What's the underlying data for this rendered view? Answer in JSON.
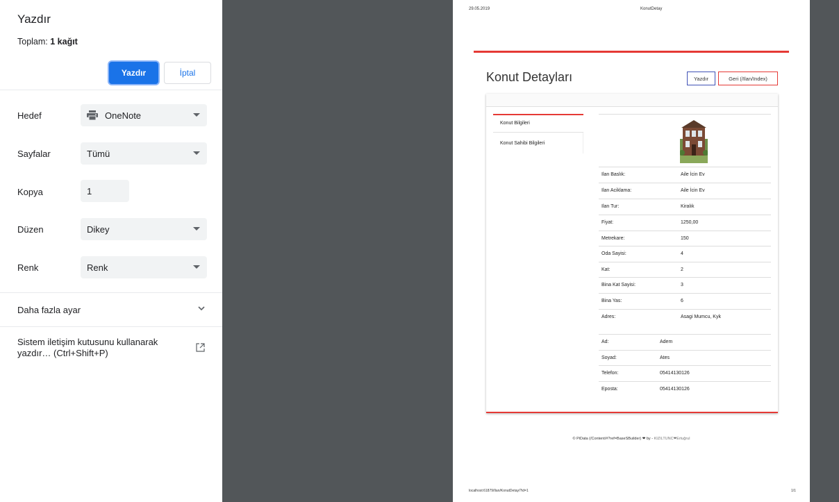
{
  "panel": {
    "title": "Yazdır",
    "total_prefix": "Toplam: ",
    "total_value": "1 kağıt",
    "print_button": "Yazdır",
    "cancel_button": "İptal",
    "rows": {
      "destination": {
        "label": "Hedef",
        "value": "OneNote"
      },
      "pages": {
        "label": "Sayfalar",
        "value": "Tümü"
      },
      "copies": {
        "label": "Kopya",
        "value": "1"
      },
      "layout": {
        "label": "Düzen",
        "value": "Dikey"
      },
      "color": {
        "label": "Renk",
        "value": "Renk"
      }
    },
    "more_settings": "Daha fazla ayar",
    "system_dialog": "Sistem iletişim kutusunu kullanarak yazdır… (Ctrl+Shift+P)",
    "accent_color": "#1a73e8"
  },
  "preview": {
    "header_date": "29.05.2019",
    "header_title": "KonutDetay",
    "page_title": "Konut Detayları",
    "print_button": "Yazdır",
    "back_button": "Geri (/Ilan/Index)",
    "tabs": [
      "Konut Bilgileri",
      "Konut Sahibi Bilgileri"
    ],
    "property": [
      {
        "key": "Ilan Baslık:",
        "value": "Aile İcin Ev"
      },
      {
        "key": "Ilan Aciklama:",
        "value": "Aile İcin Ev"
      },
      {
        "key": "Ilan Tur:",
        "value": "Kiralık"
      },
      {
        "key": "Fiyat:",
        "value": "1250,00"
      },
      {
        "key": "Metrekare:",
        "value": "150"
      },
      {
        "key": "Oda Sayisi:",
        "value": "4"
      },
      {
        "key": "Kat:",
        "value": "2"
      },
      {
        "key": "Bina Kat Sayisi:",
        "value": "3"
      },
      {
        "key": "Bina Yas:",
        "value": "6"
      },
      {
        "key": "Adres:",
        "value": "Asagi Mumcu, Kyk"
      }
    ],
    "owner": [
      {
        "key": "Ad:",
        "value": "Adem"
      },
      {
        "key": "Soyad:",
        "value": "Ates"
      },
      {
        "key": "Telefon:",
        "value": "05414130126"
      },
      {
        "key": "Eposta:",
        "value": "05414130126"
      }
    ],
    "footer_text": "© PiData (/Content/#?ref=BaseSBuilder) ❤ by -",
    "footer_name": "KIZILTUNC❤Ertuğrul",
    "footer_url": "localhost:61879/Ilan/KonutDetay/?id=1",
    "page_number": "1/1",
    "accent_color": "#e53935"
  }
}
